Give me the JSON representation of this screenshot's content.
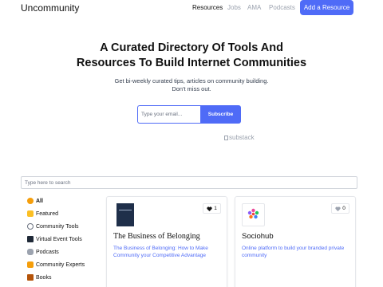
{
  "header": {
    "logo": "Uncommunity",
    "nav": [
      "Resources",
      "Jobs",
      "AMA",
      "Podcasts"
    ],
    "cta": "Add a Resource"
  },
  "hero": {
    "title_line1": "A Curated Directory Of Tools And",
    "title_line2": "Resources To Build Internet Communities",
    "sub_line1": "Get bi-weekly curated tips, articles on community building.",
    "sub_line2": "Don't miss out.",
    "email_placeholder": "Type your email...",
    "subscribe": "Subscribe",
    "substack": "substack"
  },
  "search": {
    "placeholder": "Type here to search"
  },
  "categories": [
    {
      "label": "All",
      "icon": "star-face-icon",
      "color": "#f59e0b"
    },
    {
      "label": "Featured",
      "icon": "cheering-icon",
      "color": "#d97706"
    },
    {
      "label": "Community Tools",
      "icon": "gear-icon",
      "color": "#6b7280"
    },
    {
      "label": "Virtual Event Tools",
      "icon": "monitor-icon",
      "color": "#1f2937"
    },
    {
      "label": "Podcasts",
      "icon": "microphone-icon",
      "color": "#6b7280"
    },
    {
      "label": "Community Experts",
      "icon": "handshake-icon",
      "color": "#f59e0b"
    },
    {
      "label": "Books",
      "icon": "books-icon",
      "color": "#b45309"
    }
  ],
  "cards": [
    {
      "title": "The Business of Belonging",
      "likes": "1",
      "liked": true,
      "description": "The Business of Belonging: How to Make Community your Competitive Advantage"
    },
    {
      "title": "Sociohub",
      "likes": "0",
      "liked": false,
      "description": "Online platform to build your branded private community",
      "logo_text": "sociohub"
    }
  ],
  "colors": {
    "accent": "#4f6bf7"
  }
}
